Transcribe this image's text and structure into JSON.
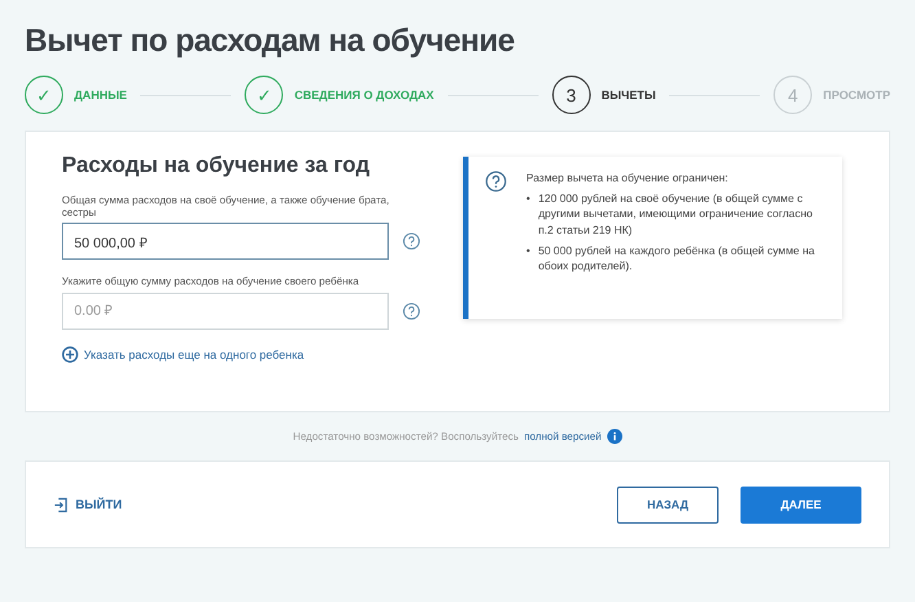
{
  "title": "Вычет по расходам на обучение",
  "steps": [
    {
      "marker": "✓",
      "label": "ДАННЫЕ",
      "completed": true,
      "current": false
    },
    {
      "marker": "✓",
      "label": "СВЕДЕНИЯ О ДОХОДАХ",
      "completed": true,
      "current": false
    },
    {
      "marker": "3",
      "label": "ВЫЧЕТЫ",
      "completed": false,
      "current": true
    },
    {
      "marker": "4",
      "label": "ПРОСМОТР",
      "completed": false,
      "current": false
    }
  ],
  "form": {
    "heading": "Расходы на обучение за год",
    "fields": [
      {
        "label": "Общая сумма расходов на своё обучение, а также обучение брата, сестры",
        "value": "50 000,00 ₽",
        "focused": true
      },
      {
        "label": "Укажите общую сумму расходов на обучение своего ребёнка",
        "placeholder": "0.00 ₽",
        "focused": false
      }
    ],
    "add_link": "Указать расходы еще на одного ребенка"
  },
  "info": {
    "intro": "Размер вычета на обучение ограничен:",
    "items": [
      {
        "bullet": "•",
        "text": "120 000 рублей на своё обучение (в общей сумме с другими вычетами, имеющими ограничение согласно п.2 статьи 219 НК)"
      },
      {
        "bullet": "•",
        "text": "50 000 рублей на каждого ребёнка (в общей сумме на обоих родителей)."
      }
    ]
  },
  "note": {
    "text": "Недостаточно возможностей? Воспользуйтесь",
    "link": "полной версией"
  },
  "footer": {
    "exit": "ВЫЙТИ",
    "back": "НАЗАД",
    "next": "ДАЛЕЕ"
  }
}
